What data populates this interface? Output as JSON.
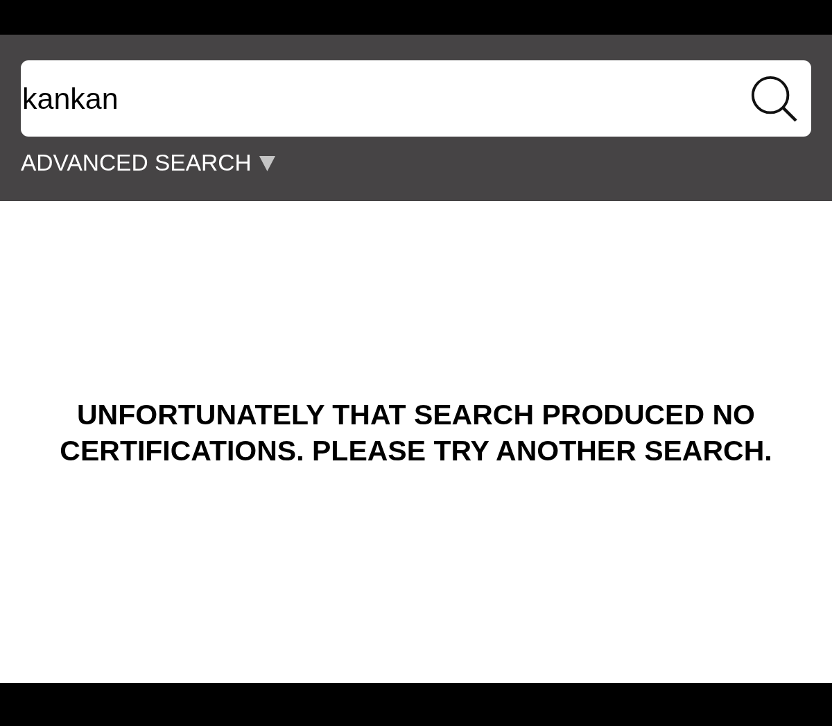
{
  "search": {
    "value": "kankan"
  },
  "advanced_search": {
    "label": "ADVANCED SEARCH",
    "expanded": false
  },
  "message": "UNFORTUNATELY THAT SEARCH PRODUCED NO CERTIFICATIONS. PLEASE TRY ANOTHER SEARCH."
}
